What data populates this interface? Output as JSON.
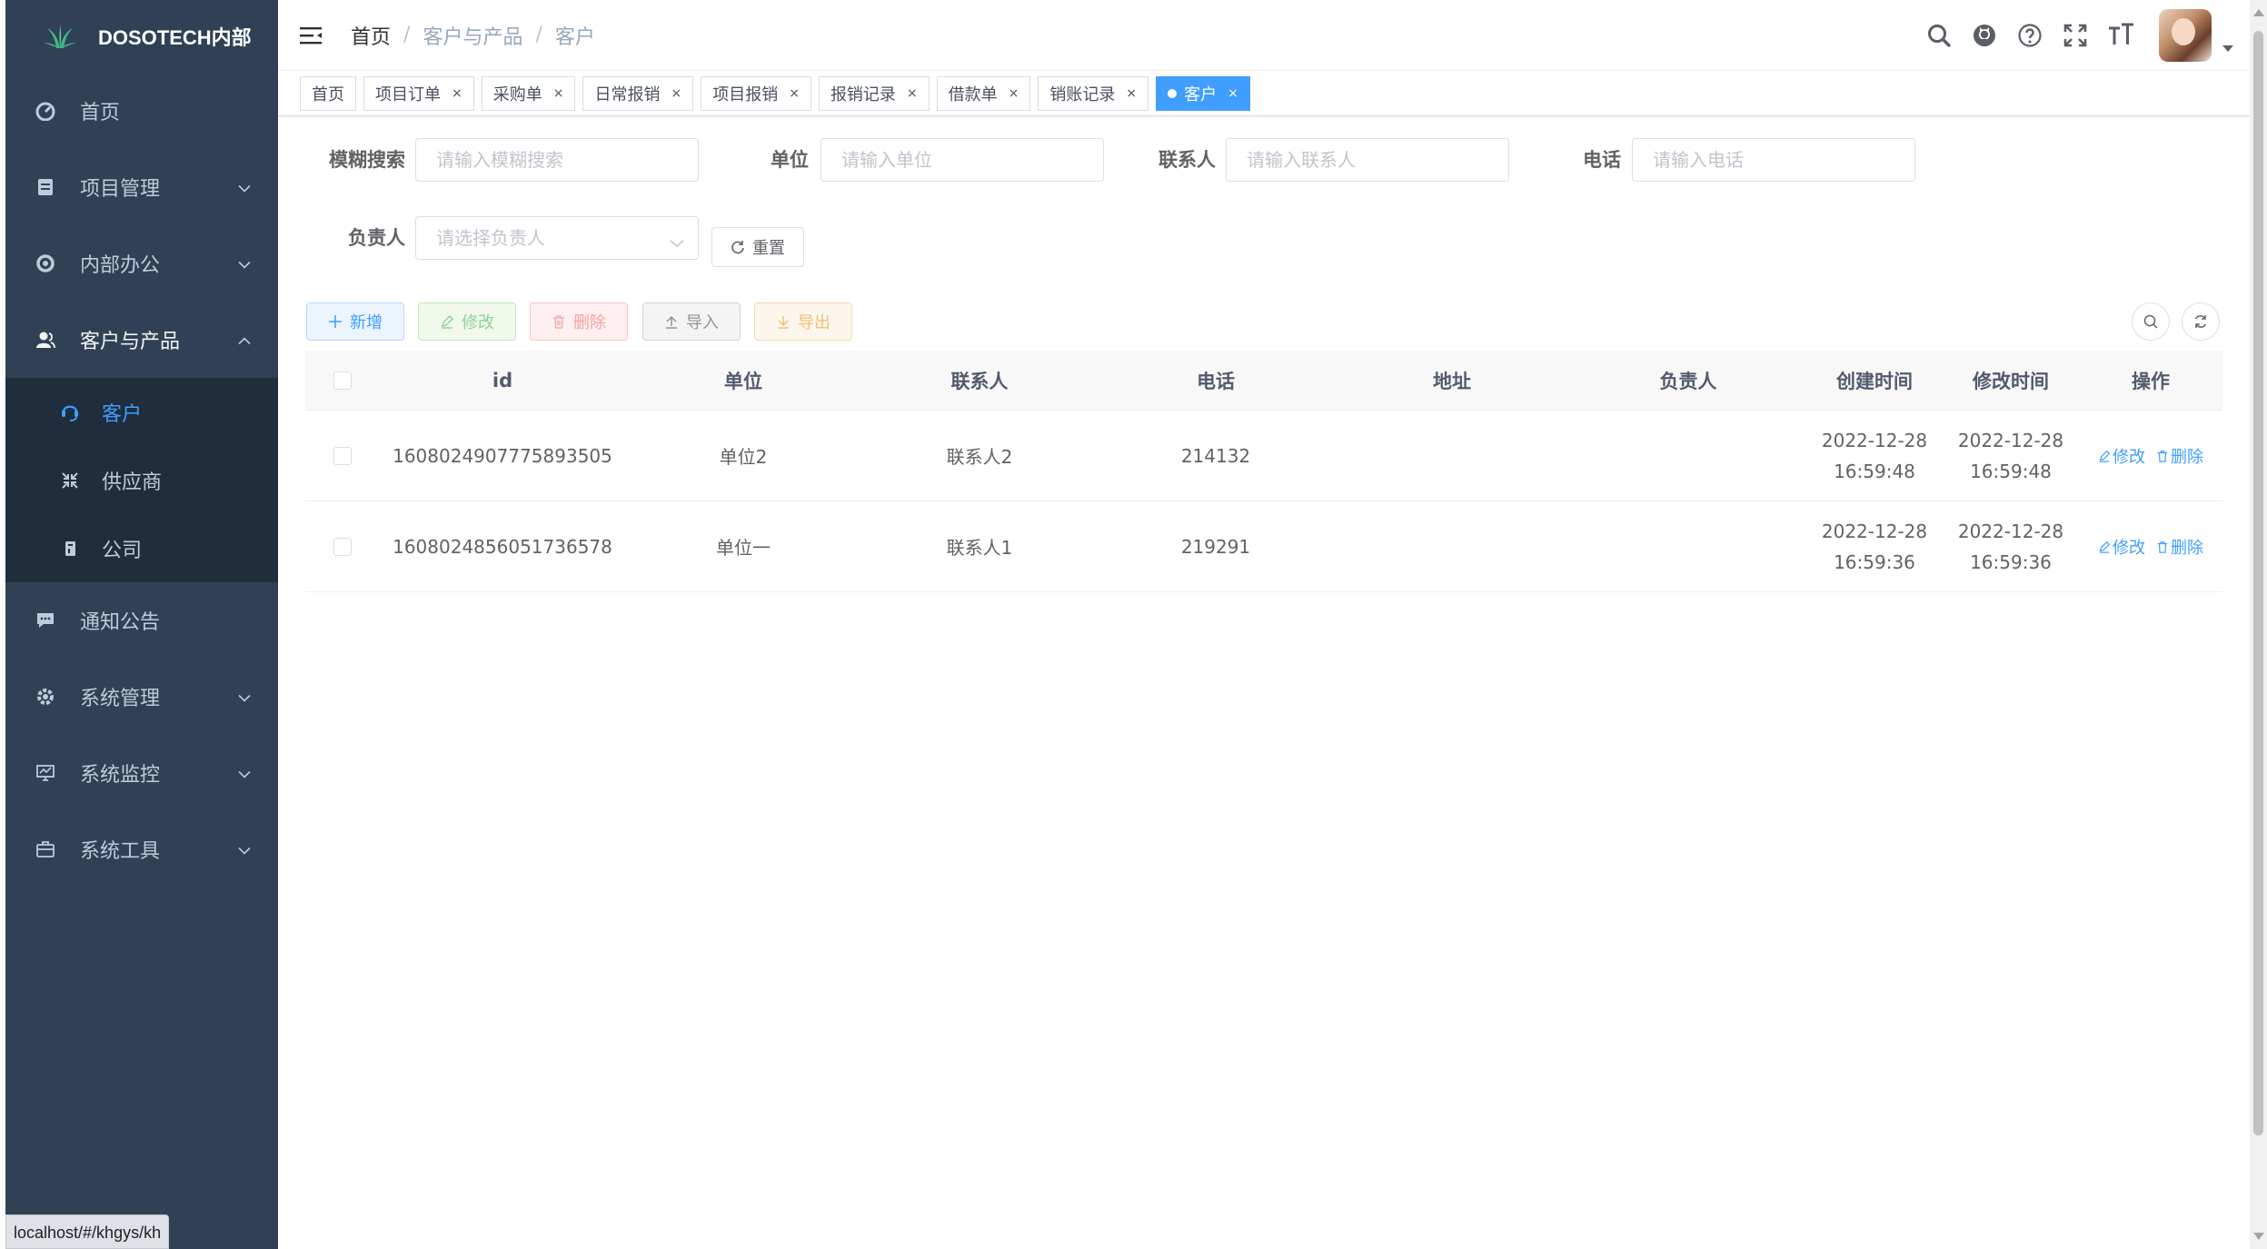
{
  "app": {
    "logo_text": "DOSOTECH内部"
  },
  "sidebar": {
    "items": [
      {
        "label": "首页",
        "icon": "dashboard-icon"
      },
      {
        "label": "项目管理",
        "icon": "document-icon"
      },
      {
        "label": "内部办公",
        "icon": "office-icon"
      },
      {
        "label": "客户与产品",
        "icon": "user-group-icon"
      },
      {
        "label": "通知公告",
        "icon": "message-icon"
      },
      {
        "label": "系统管理",
        "icon": "settings-icon"
      },
      {
        "label": "系统监控",
        "icon": "monitor-icon"
      },
      {
        "label": "系统工具",
        "icon": "toolbox-icon"
      }
    ],
    "submenu": [
      {
        "label": "客户",
        "icon": "customer-icon",
        "active": true
      },
      {
        "label": "供应商",
        "icon": "supplier-icon"
      },
      {
        "label": "公司",
        "icon": "company-icon"
      }
    ]
  },
  "status_url": "localhost/#/khgys/kh",
  "breadcrumb": [
    "首页",
    "客户与产品",
    "客户"
  ],
  "tags": [
    "首页",
    "项目订单",
    "采购单",
    "日常报销",
    "项目报销",
    "报销记录",
    "借款单",
    "销账记录",
    "客户"
  ],
  "form": {
    "fuzzy_label": "模糊搜索",
    "fuzzy_placeholder": "请输入模糊搜索",
    "unit_label": "单位",
    "unit_placeholder": "请输入单位",
    "contact_label": "联系人",
    "contact_placeholder": "请输入联系人",
    "phone_label": "电话",
    "phone_placeholder": "请输入电话",
    "owner_label": "负责人",
    "owner_placeholder": "请选择负责人",
    "reset_label": "重置"
  },
  "toolbar": {
    "add_label": "新增",
    "edit_label": "修改",
    "delete_label": "删除",
    "import_label": "导入",
    "export_label": "导出"
  },
  "table": {
    "headers": [
      "id",
      "单位",
      "联系人",
      "电话",
      "地址",
      "负责人",
      "创建时间",
      "修改时间",
      "操作"
    ],
    "rows": [
      {
        "id": "1608024907775893505",
        "unit": "单位2",
        "contact": "联系人2",
        "phone": "214132",
        "address": "",
        "owner": "",
        "created_date": "2022-12-28",
        "created_time": "16:59:48",
        "modified_date": "2022-12-28",
        "modified_time": "16:59:48"
      },
      {
        "id": "1608024856051736578",
        "unit": "单位一",
        "contact": "联系人1",
        "phone": "219291",
        "address": "",
        "owner": "",
        "created_date": "2022-12-28",
        "created_time": "16:59:36",
        "modified_date": "2022-12-28",
        "modified_time": "16:59:36"
      }
    ],
    "op_edit": "修改",
    "op_delete": "删除"
  },
  "colors": {
    "sidebar_bg": "#304156",
    "submenu_bg": "#1f2d3d",
    "primary": "#409eff"
  }
}
